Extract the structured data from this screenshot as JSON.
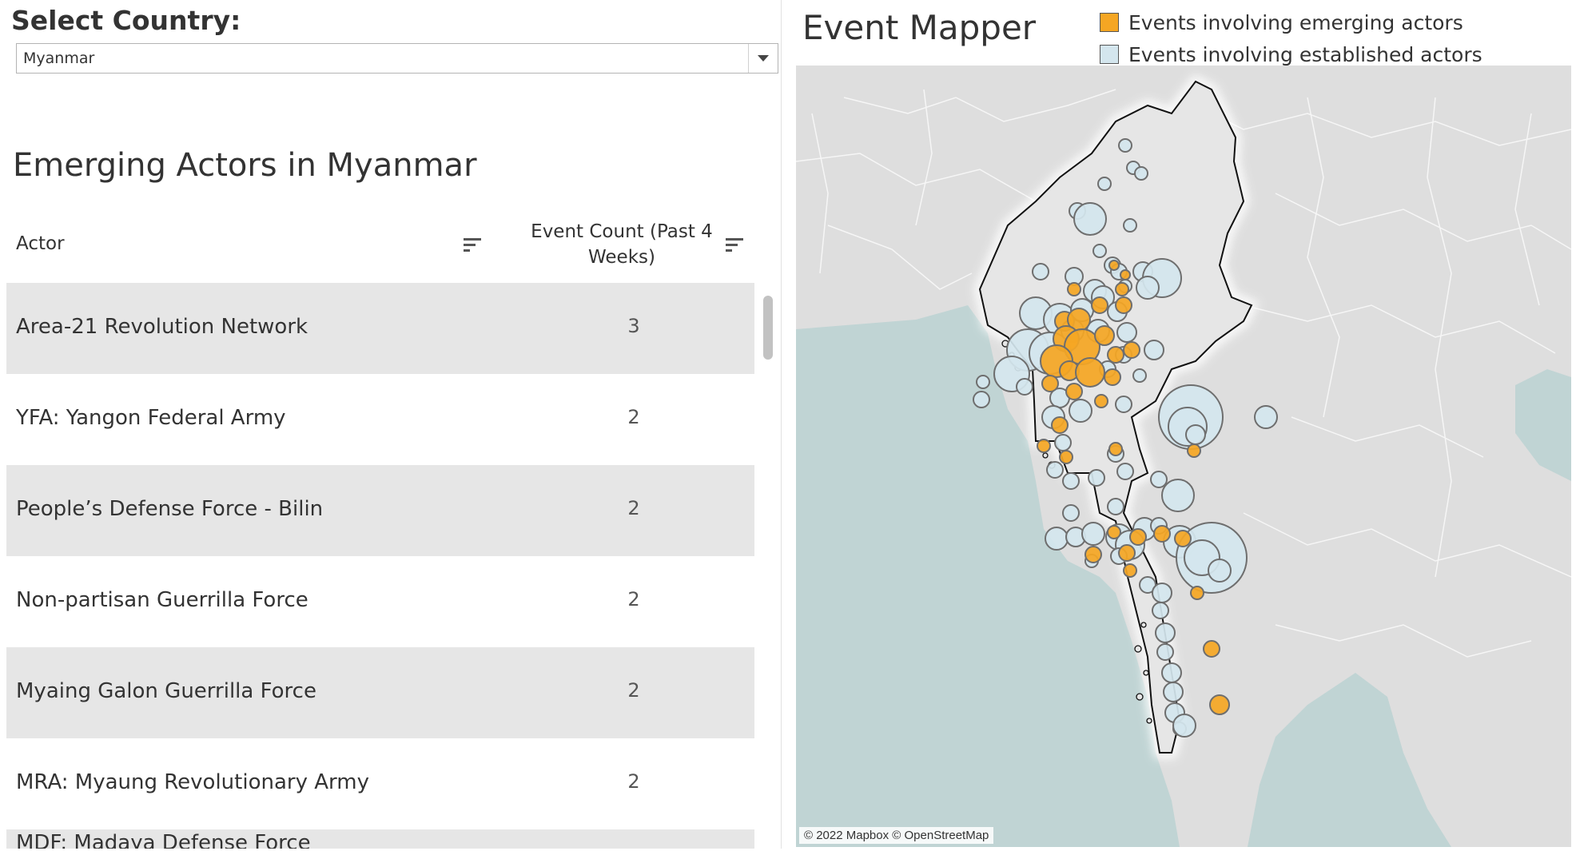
{
  "filter": {
    "title": "Select Country:",
    "selected": "Myanmar"
  },
  "table": {
    "title": "Emerging Actors in Myanmar",
    "col_actor": "Actor",
    "col_count": "Event Count (Past 4 Weeks)",
    "rows": [
      {
        "actor": "Area-21 Revolution Network",
        "count": "3"
      },
      {
        "actor": "YFA: Yangon Federal Army",
        "count": "2"
      },
      {
        "actor": "People’s Defense Force - Bilin",
        "count": "2"
      },
      {
        "actor": "Non-partisan Guerrilla Force",
        "count": "2"
      },
      {
        "actor": "Myaing Galon Guerrilla Force",
        "count": "2"
      },
      {
        "actor": "MRA: Myaung Revolutionary Army",
        "count": "2"
      },
      {
        "actor": "MDF: Madaya Defense Force",
        "count": ""
      }
    ]
  },
  "map": {
    "title": "Event Mapper",
    "attribution": "© 2022 Mapbox © OpenStreetMap",
    "legend": [
      {
        "label": "Events involving emerging actors",
        "color": "#f5a623"
      },
      {
        "label": "Events involving established actors",
        "color": "#d4e6ee"
      }
    ],
    "colors": {
      "land": "#dedede",
      "water": "#c0d4d4",
      "emerging": "#f5a623",
      "established": "#d4e6ee",
      "marker_stroke": "#6e6e6e"
    }
  }
}
